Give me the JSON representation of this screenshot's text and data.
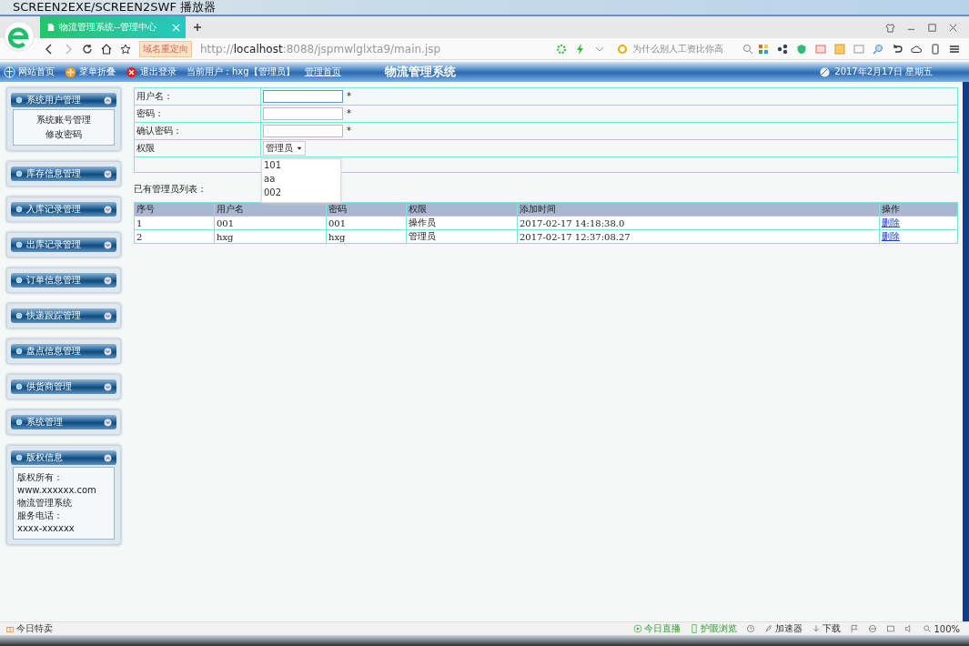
{
  "player": {
    "title": "SCREEN2EXE/SCREEN2SWF 播放器"
  },
  "browser": {
    "tab": {
      "title": "物流管理系统--管理中心",
      "selected": true
    },
    "badge": "域名重定向",
    "url": {
      "scheme": "http://",
      "host": "localhost",
      "path": ":8088/jspmwlglxta9/main.jsp"
    },
    "search": {
      "placeholder": "为什么别人工资比你高"
    }
  },
  "header": {
    "links": [
      {
        "label": "网站首页",
        "kind": "home"
      },
      {
        "label": "菜单折叠",
        "kind": "fold"
      },
      {
        "label": "退出登录",
        "kind": "logout"
      }
    ],
    "current_user": "当前用户：hxg【管理员】",
    "home_link": "管理首页",
    "title": "物流管理系统",
    "date": "2017年2月17日 星期五"
  },
  "sidebar": {
    "sections": [
      {
        "title": "系统用户管理",
        "expanded": true,
        "kind": "menu",
        "items": [
          "系统账号管理",
          "修改密码"
        ]
      },
      {
        "title": "库存信息管理",
        "expanded": false,
        "kind": "menu"
      },
      {
        "title": "入库记录管理",
        "expanded": false,
        "kind": "menu"
      },
      {
        "title": "出库记录管理",
        "expanded": false,
        "kind": "menu"
      },
      {
        "title": "订单信息管理",
        "expanded": false,
        "kind": "menu"
      },
      {
        "title": "快递跟踪管理",
        "expanded": false,
        "kind": "menu"
      },
      {
        "title": "盘点信息管理",
        "expanded": false,
        "kind": "menu"
      },
      {
        "title": "供货商管理",
        "expanded": false,
        "kind": "menu"
      },
      {
        "title": "系统管理",
        "expanded": false,
        "kind": "menu"
      },
      {
        "title": "版权信息",
        "expanded": true,
        "kind": "info",
        "items": [
          "版权所有：",
          "www.xxxxxx.com",
          "物流管理系统",
          "服务电话：",
          "xxxx-xxxxxx"
        ]
      }
    ]
  },
  "form": {
    "fields": [
      {
        "label": "用户名：",
        "kind": "text",
        "required": "*",
        "focused": true
      },
      {
        "label": "密码：",
        "kind": "text",
        "required": "*",
        "focused": false
      },
      {
        "label": "确认密码：",
        "kind": "text",
        "required": "*",
        "focused": false
      },
      {
        "label": "权限",
        "kind": "select",
        "value": "管理员"
      }
    ],
    "autocomplete": [
      "101",
      "aa",
      "002"
    ]
  },
  "list_caption": "已有管理员列表：",
  "table": {
    "columns": [
      "序号",
      "用户名",
      "密码",
      "权限",
      "添加时间",
      "操作"
    ],
    "rows": [
      {
        "cells": [
          "1",
          "001",
          "001",
          "操作员",
          "2017-02-17 14:18:38.0"
        ],
        "action": "删除"
      },
      {
        "cells": [
          "2",
          "hxg",
          "hxg",
          "管理员",
          "2017-02-17 12:37:08.27"
        ],
        "action": "删除"
      }
    ]
  },
  "status_bar": {
    "left": "今日特卖",
    "right": [
      {
        "label": "今日直播",
        "kind": "live"
      },
      {
        "label": "护眼浏览",
        "kind": "eye"
      },
      {
        "kind": "history"
      },
      {
        "label": "加速器",
        "kind": "rocket"
      },
      {
        "label": "下载",
        "kind": "download"
      },
      {
        "kind": "flag"
      },
      {
        "kind": "ie"
      },
      {
        "kind": "window"
      },
      {
        "kind": "sound"
      },
      {
        "label": "100%",
        "kind": "zoom"
      }
    ]
  }
}
